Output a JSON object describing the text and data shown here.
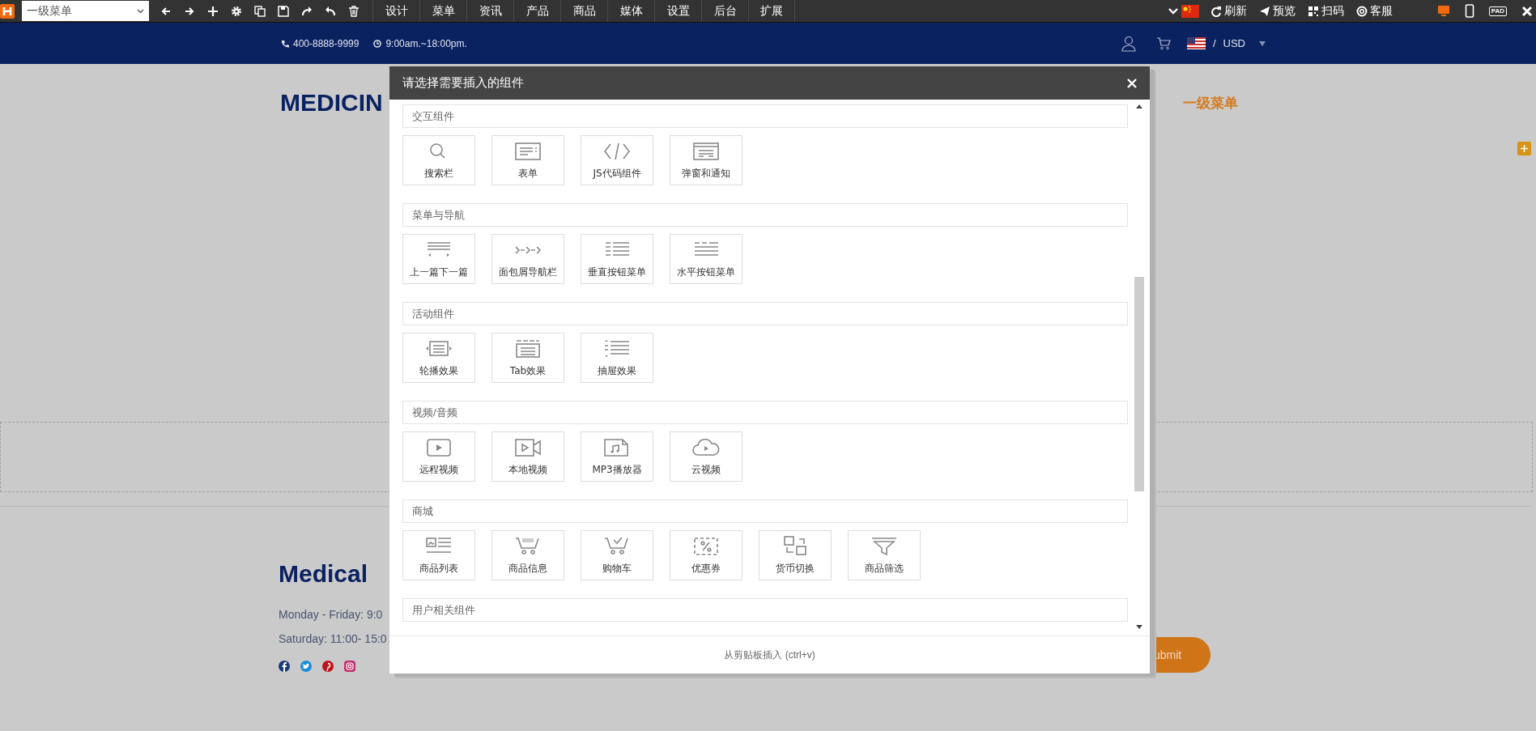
{
  "toolbar": {
    "page_select": {
      "value": "一级菜单"
    },
    "tools": [
      {
        "kind": "back"
      },
      {
        "kind": "forward"
      },
      {
        "kind": "add"
      },
      {
        "kind": "settings"
      },
      {
        "kind": "copy"
      },
      {
        "kind": "save"
      },
      {
        "kind": "redo"
      },
      {
        "kind": "undo"
      },
      {
        "kind": "delete"
      }
    ],
    "menu_tabs": [
      {
        "label": "设计"
      },
      {
        "label": "菜单"
      },
      {
        "label": "资讯"
      },
      {
        "label": "产品"
      },
      {
        "label": "商品"
      },
      {
        "label": "媒体"
      },
      {
        "label": "设置"
      },
      {
        "label": "后台"
      },
      {
        "label": "扩展"
      }
    ],
    "actions": [
      {
        "label": "刷新",
        "kind": "refresh"
      },
      {
        "label": "预览",
        "kind": "preview"
      },
      {
        "label": "扫码",
        "kind": "scan"
      },
      {
        "label": "客服",
        "kind": "support"
      }
    ],
    "device_views": [
      {
        "kind": "desktop",
        "selected": true
      },
      {
        "kind": "phone",
        "selected": false
      },
      {
        "kind": "pad",
        "label": "PAD",
        "selected": false
      }
    ]
  },
  "top_bar": {
    "phone": "400-8888-9999",
    "hours": "9:00am.~18:00pm.",
    "separator": "/",
    "currency": "USD"
  },
  "page": {
    "logo": "MEDICIN",
    "nav_item": "一级菜单",
    "footer": {
      "title": "Medical",
      "hours": [
        "Monday - Friday: 9:0",
        "Saturday: 11:00- 15:0"
      ],
      "submit": "ubmit"
    }
  },
  "dialog": {
    "title": "请选择需要插入的组件",
    "sections": [
      {
        "title": "交互组件",
        "items": [
          {
            "label": "搜索栏",
            "kind": "search"
          },
          {
            "label": "表单",
            "kind": "form"
          },
          {
            "label": "JS代码组件",
            "kind": "code"
          },
          {
            "label": "弹窗和通知",
            "kind": "popup"
          }
        ]
      },
      {
        "title": "菜单与导航",
        "items": [
          {
            "label": "上一篇下一篇",
            "kind": "prevnext"
          },
          {
            "label": "面包屑导航栏",
            "kind": "breadcrumb"
          },
          {
            "label": "垂直按钮菜单",
            "kind": "vmenu"
          },
          {
            "label": "水平按钮菜单",
            "kind": "hmenu"
          }
        ]
      },
      {
        "title": "活动组件",
        "items": [
          {
            "label": "轮播效果",
            "kind": "carousel"
          },
          {
            "label": "Tab效果",
            "kind": "tab"
          },
          {
            "label": "抽屉效果",
            "kind": "drawer"
          }
        ]
      },
      {
        "title": "视频/音频",
        "items": [
          {
            "label": "远程视频",
            "kind": "remote-video"
          },
          {
            "label": "本地视频",
            "kind": "local-video"
          },
          {
            "label": "MP3播放器",
            "kind": "mp3"
          },
          {
            "label": "云视频",
            "kind": "cloud-video"
          }
        ]
      },
      {
        "title": "商城",
        "items": [
          {
            "label": "商品列表",
            "kind": "product-list"
          },
          {
            "label": "商品信息",
            "kind": "product-info"
          },
          {
            "label": "购物车",
            "kind": "cart"
          },
          {
            "label": "优惠券",
            "kind": "coupon"
          },
          {
            "label": "货币切换",
            "kind": "currency"
          },
          {
            "label": "商品筛选",
            "kind": "filter"
          }
        ]
      },
      {
        "title": "用户相关组件"
      }
    ],
    "paste_hint": "从剪贴板插入 (ctrl+v)"
  }
}
